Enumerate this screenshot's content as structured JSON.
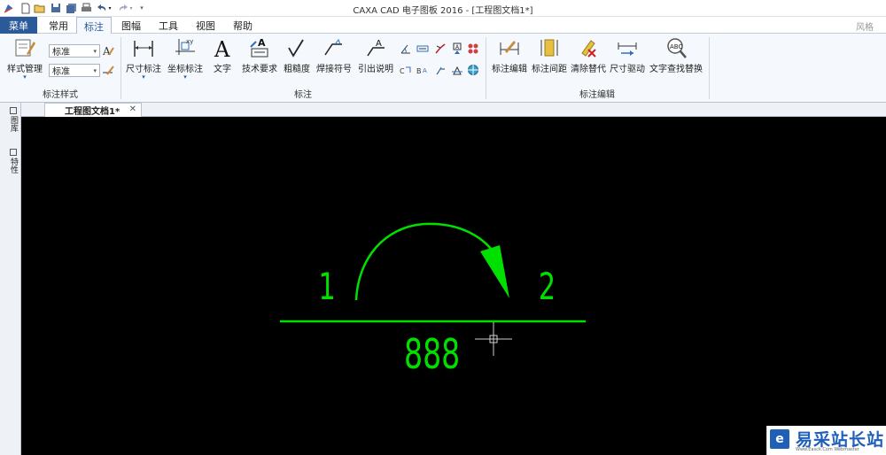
{
  "window": {
    "title": "CAXA CAD 电子图板 2016 - [工程图文档1*]"
  },
  "menubar": {
    "menu_button": "菜单",
    "tabs": [
      "常用",
      "标注",
      "图幅",
      "工具",
      "视图",
      "帮助"
    ],
    "active_tab": "标注",
    "style": "风格"
  },
  "ribbon": {
    "style_group": {
      "label": "标注样式",
      "style_manage": "样式管理",
      "text_style_value": "标准",
      "dim_style_value": "标准"
    },
    "dim_group": {
      "label": "标注",
      "buttons": [
        "尺寸标注",
        "坐标标注",
        "文字",
        "技术要求",
        "粗糙度",
        "焊接符号",
        "引出说明"
      ]
    },
    "edit_group": {
      "label": "标注编辑",
      "buttons": [
        "标注编辑",
        "标注间距",
        "清除替代",
        "尺寸驱动",
        "文字查找替换"
      ]
    }
  },
  "doc_tab": {
    "label": "工程图文档1*"
  },
  "sidebar": {
    "items": [
      "图库",
      "特性"
    ]
  },
  "canvas": {
    "background": "#000000",
    "entity_color": "#00e000",
    "texts": {
      "left_label": "1",
      "right_label": "2",
      "bottom_label": "888"
    }
  },
  "watermark": {
    "text": "易采站长站",
    "sub": "Www.Easck.Com Webmaster"
  }
}
